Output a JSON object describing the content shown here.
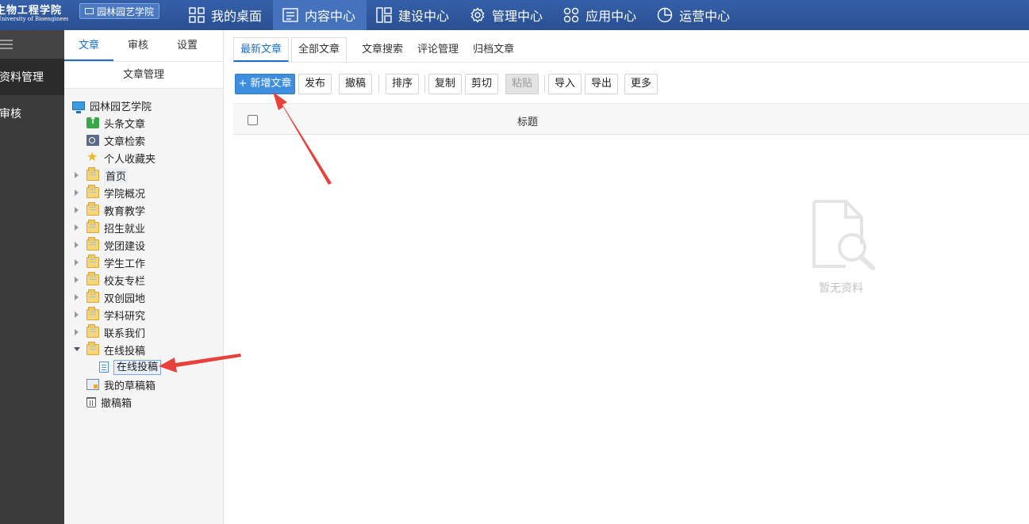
{
  "header": {
    "logo_cn": "生物工程学院",
    "logo_en": "University of Bioengineering",
    "site_button": "园林园艺学院",
    "nav": [
      {
        "label": "我的桌面",
        "icon": "grid-icon"
      },
      {
        "label": "内容中心",
        "icon": "document-icon",
        "active": true
      },
      {
        "label": "建设中心",
        "icon": "layout-icon"
      },
      {
        "label": "管理中心",
        "icon": "gear-icon"
      },
      {
        "label": "应用中心",
        "icon": "apps-icon"
      },
      {
        "label": "运营中心",
        "icon": "pie-chart-icon"
      }
    ]
  },
  "sidebar": {
    "menu_icon": "menu-icon",
    "items": [
      {
        "label": "资料管理",
        "active": true
      },
      {
        "label": "审核"
      }
    ]
  },
  "tree_panel": {
    "tabs": [
      "文章",
      "审核",
      "设置"
    ],
    "header": "文章管理",
    "nodes": [
      {
        "label": "园林园艺学院",
        "icon": "monitor-icon"
      },
      {
        "label": "头条文章",
        "icon": "up-arrow-icon"
      },
      {
        "label": "文章检索",
        "icon": "search-doc-icon"
      },
      {
        "label": "个人收藏夹",
        "icon": "star-icon"
      },
      {
        "label": "首页",
        "icon": "folder-icon"
      },
      {
        "label": "学院概况",
        "icon": "folder-icon"
      },
      {
        "label": "教育教学",
        "icon": "folder-icon"
      },
      {
        "label": "招生就业",
        "icon": "folder-icon"
      },
      {
        "label": "党团建设",
        "icon": "folder-icon"
      },
      {
        "label": "学生工作",
        "icon": "folder-icon"
      },
      {
        "label": "校友专栏",
        "icon": "folder-icon"
      },
      {
        "label": "双创园地",
        "icon": "folder-icon"
      },
      {
        "label": "学科研究",
        "icon": "folder-icon"
      },
      {
        "label": "联系我们",
        "icon": "folder-icon"
      },
      {
        "label": "在线投稿",
        "icon": "folder-icon"
      },
      {
        "label": "在线投稿",
        "icon": "document-icon",
        "selected": true
      },
      {
        "label": "我的草稿箱",
        "icon": "draft-icon"
      },
      {
        "label": "撤稿箱",
        "icon": "trash-icon"
      }
    ]
  },
  "main": {
    "tabs": [
      "最新文章",
      "全部文章",
      "文章搜索",
      "评论管理",
      "归档文章"
    ],
    "toolbar": {
      "add": "+ 新增文章",
      "publish": "发布",
      "withdraw": "撤稿",
      "sort": "排序",
      "copy": "复制",
      "cut": "剪切",
      "paste": "粘贴",
      "import": "导入",
      "export": "导出",
      "more": "更多"
    },
    "grid": {
      "title_col": "标题"
    },
    "empty_text": "暂无资料",
    "empty_icon": "empty-search-doc-icon"
  },
  "colors": {
    "topbar": "#2f5597",
    "primary": "#3e8ee0",
    "annotation_arrow": "#e8403a"
  }
}
